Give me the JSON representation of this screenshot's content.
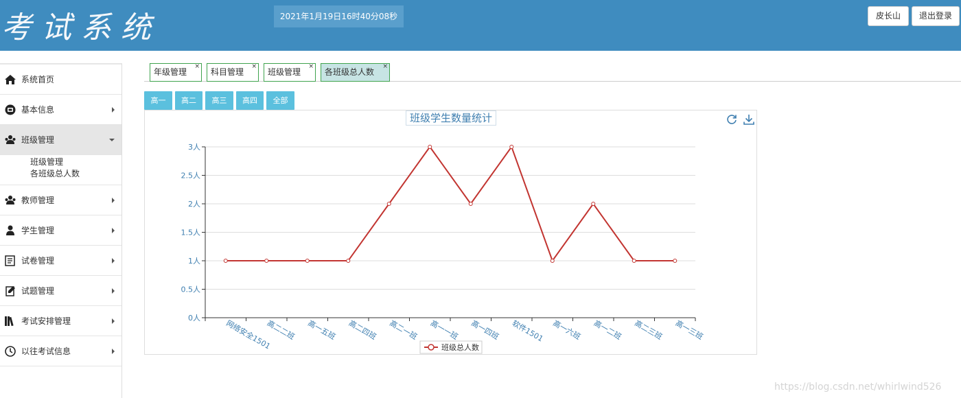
{
  "header": {
    "logo_text": "考试系统",
    "datetime": "2021年1月19日16时40分08秒",
    "user_button": "皮长山",
    "logout_button": "退出登录"
  },
  "sidebar": {
    "items": [
      {
        "label": "系统首页",
        "icon": "home-icon"
      },
      {
        "label": "基本信息",
        "icon": "info-icon"
      },
      {
        "label": "班级管理",
        "icon": "class-icon",
        "expanded": true
      },
      {
        "label": "教师管理",
        "icon": "teacher-icon"
      },
      {
        "label": "学生管理",
        "icon": "student-icon"
      },
      {
        "label": "试卷管理",
        "icon": "paper-icon"
      },
      {
        "label": "试题管理",
        "icon": "question-icon"
      },
      {
        "label": "考试安排管理",
        "icon": "books-icon"
      },
      {
        "label": "以往考试信息",
        "icon": "clock-icon"
      }
    ],
    "submenu": [
      "班级管理",
      "各班级总人数"
    ]
  },
  "tabs": [
    {
      "label": "年级管理",
      "close": "×"
    },
    {
      "label": "科目管理",
      "close": "×"
    },
    {
      "label": "班级管理",
      "close": "×"
    },
    {
      "label": "各班级总人数",
      "close": "×",
      "active": true
    }
  ],
  "grade_buttons": [
    "高一",
    "高二",
    "高三",
    "高四",
    "全部"
  ],
  "chart_data": {
    "type": "line",
    "title": "班级学生数量统计",
    "categories": [
      "网络安全1501",
      "高二二班",
      "高一五班",
      "高二四班",
      "高二一班",
      "高一一班",
      "高一四班",
      "软件1501",
      "高一六班",
      "高一二班",
      "高二三班",
      "高一三班"
    ],
    "series": [
      {
        "name": "班级总人数",
        "values": [
          1,
          1,
          1,
          1,
          2,
          3,
          2,
          3,
          1,
          2,
          1,
          1
        ],
        "color": "#c23531"
      }
    ],
    "y_ticks": [
      "0人",
      "0.5人",
      "1人",
      "1.5人",
      "2人",
      "2.5人",
      "3人"
    ],
    "ylim": [
      0,
      3
    ],
    "grid": true,
    "legend_position": "bottom"
  },
  "watermark": "https://blog.csdn.net/whirlwind526"
}
